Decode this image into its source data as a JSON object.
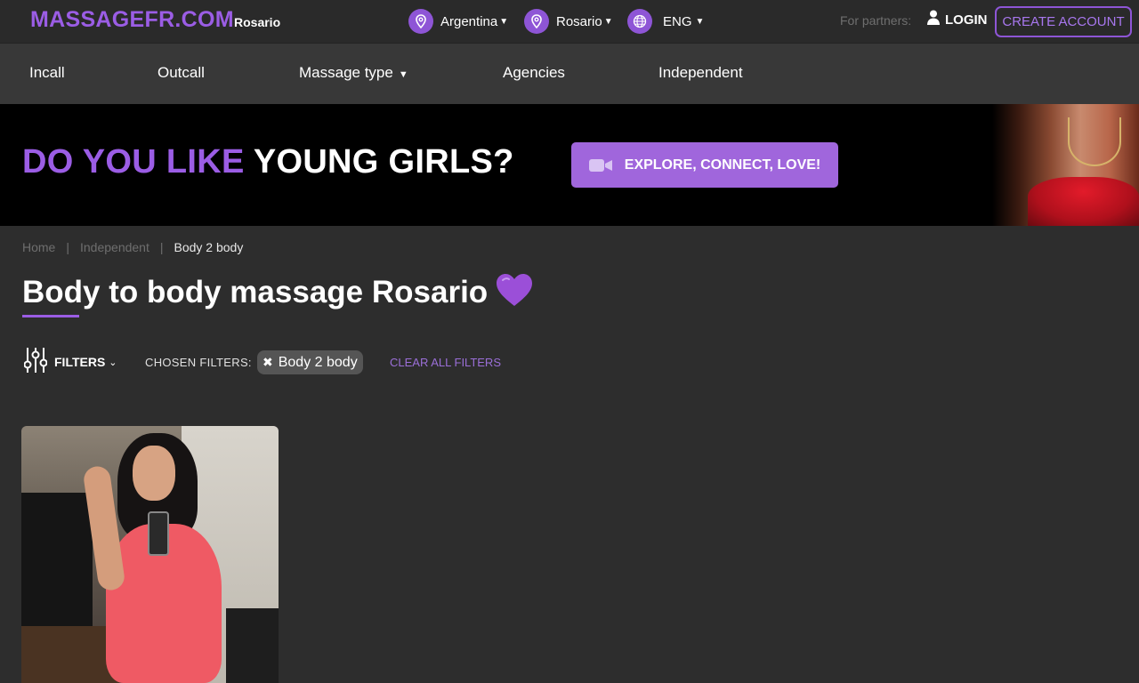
{
  "header": {
    "logo": "MASSAGEFR.COM",
    "city": "Rosario",
    "country_selector": "Argentina",
    "city_selector": "Rosario",
    "language_selector": "ENG",
    "partners_label": "For partners:",
    "login_label": "LOGIN",
    "create_account_label": "CREATE ACCOUNT"
  },
  "nav": {
    "items": [
      {
        "label": "Incall"
      },
      {
        "label": "Outcall"
      },
      {
        "label": "Massage type"
      },
      {
        "label": "Agencies"
      },
      {
        "label": "Independent"
      }
    ]
  },
  "banner": {
    "text_purple": "DO YOU LIKE",
    "text_white": "YOUNG GIRLS?",
    "cta_label": "EXPLORE, CONNECT, LOVE!"
  },
  "breadcrumb": {
    "items": [
      "Home",
      "Independent"
    ],
    "current": "Body 2 body"
  },
  "page": {
    "title": "Body to body massage Rosario"
  },
  "filters": {
    "filters_label": "FILTERS",
    "chosen_label": "CHOSEN FILTERS:",
    "chips": [
      "Body 2 body"
    ],
    "clear_all_label": "CLEAR ALL FILTERS"
  },
  "colors": {
    "accent": "#9b5de5",
    "background": "#2d2d2d",
    "nav_background": "#383838",
    "cta_background": "#a066dc"
  },
  "icons": {
    "country": "map-pin-icon",
    "city": "map-pin-icon",
    "language": "globe-icon",
    "login": "user-icon",
    "cta": "video-camera-icon",
    "filters": "sliders-icon",
    "heart": "purple-heart-icon",
    "chip_remove": "close-icon"
  }
}
